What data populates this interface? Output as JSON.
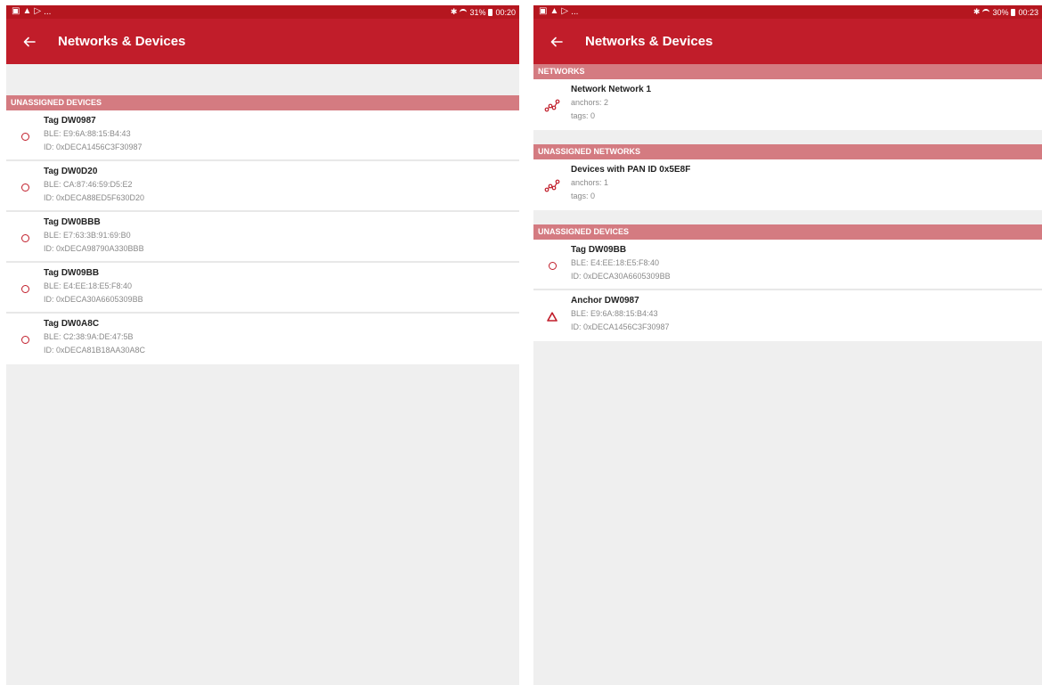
{
  "colors": {
    "status_bar": "#b5161f",
    "app_bar": "#c11d2a",
    "section_header": "#d47b81",
    "accent": "#c11d2a",
    "background": "#efefef"
  },
  "left": {
    "status": {
      "indicator_dots": "...",
      "battery_percent": "31%",
      "time": "00:20"
    },
    "app_bar": {
      "title": "Networks & Devices"
    },
    "unassigned_devices_header": "UNASSIGNED DEVICES",
    "devices": [
      {
        "name": "Tag DW0987",
        "ble": "BLE: E9:6A:88:15:B4:43",
        "id": "ID: 0xDECA1456C3F30987",
        "icon": "circle-icon"
      },
      {
        "name": "Tag DW0D20",
        "ble": "BLE: CA:87:46:59:D5:E2",
        "id": "ID: 0xDECA88ED5F630D20",
        "icon": "circle-icon"
      },
      {
        "name": "Tag DW0BBB",
        "ble": "BLE: E7:63:3B:91:69:B0",
        "id": "ID: 0xDECA98790A330BBB",
        "icon": "circle-icon"
      },
      {
        "name": "Tag DW09BB",
        "ble": "BLE: E4:EE:18:E5:F8:40",
        "id": "ID: 0xDECA30A6605309BB",
        "icon": "circle-icon"
      },
      {
        "name": "Tag DW0A8C",
        "ble": "BLE: C2:38:9A:DE:47:5B",
        "id": "ID: 0xDECA81B18AA30A8C",
        "icon": "circle-icon"
      }
    ]
  },
  "right": {
    "status": {
      "indicator_dots": "...",
      "battery_percent": "30%",
      "time": "00:23"
    },
    "app_bar": {
      "title": "Networks & Devices"
    },
    "networks_header": "NETWORKS",
    "networks": [
      {
        "name": "Network Network 1",
        "anchors": "anchors: 2",
        "tags": "tags: 0",
        "icon": "network-icon"
      }
    ],
    "unassigned_networks_header": "UNASSIGNED NETWORKS",
    "unassigned_networks": [
      {
        "name": "Devices with PAN ID 0x5E8F",
        "anchors": "anchors: 1",
        "tags": "tags: 0",
        "icon": "network-icon"
      }
    ],
    "unassigned_devices_header": "UNASSIGNED DEVICES",
    "devices": [
      {
        "name": "Tag DW09BB",
        "ble": "BLE: E4:EE:18:E5:F8:40",
        "id": "ID: 0xDECA30A6605309BB",
        "icon": "circle-icon"
      },
      {
        "name": "Anchor DW0987",
        "ble": "BLE: E9:6A:88:15:B4:43",
        "id": "ID: 0xDECA1456C3F30987",
        "icon": "triangle-icon"
      }
    ]
  }
}
